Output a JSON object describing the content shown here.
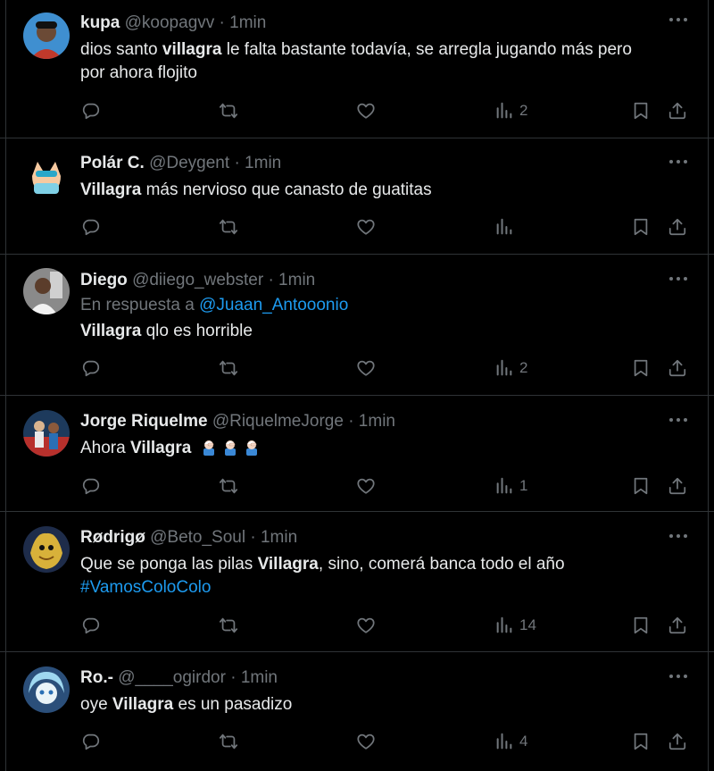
{
  "tweets": [
    {
      "name": "kupa",
      "handle": "@koopagvv",
      "sep": "·",
      "time": "1min",
      "text": {
        "a": "dios santo ",
        "b": "villagra",
        "c": " le falta bastante todavía, se arregla jugando más pero",
        "d": "por ahora flojito"
      },
      "views": "2"
    },
    {
      "name": "Polár C.",
      "handle": "@Deygent",
      "sep": "·",
      "time": "1min",
      "text": {
        "b": "Villagra",
        "c": " más nervioso que canasto de guatitas"
      },
      "views": ""
    },
    {
      "name": "Diego",
      "handle": "@diiego_webster",
      "sep": "·",
      "time": "1min",
      "reply_prefix": "En respuesta a ",
      "reply_to": "@Juaan_Antooonio",
      "text": {
        "b": "Villagra",
        "c": " qlo es horrible"
      },
      "views": "2"
    },
    {
      "name": "Jorge Riquelme",
      "handle": "@RiquelmeJorge",
      "sep": "·",
      "time": "1min",
      "text": {
        "a": "Ahora ",
        "b": "Villagra"
      },
      "emoji": [
        "person-facepalming-emoji",
        "person-facepalming-emoji",
        "person-facepalming-emoji"
      ],
      "views": "1"
    },
    {
      "name": "Rødrigø",
      "handle": "@Beto_Soul",
      "sep": "·",
      "time": "1min",
      "text": {
        "a": "Que se ponga las pilas ",
        "b": "Villagra",
        "c": ", sino, comerá banca todo el año",
        "hashtag": "#VamosColoColo"
      },
      "views": "14"
    },
    {
      "name": "Ro.-",
      "handle": "@____ogirdor",
      "sep": "·",
      "time": "1min",
      "text": {
        "a": "oye ",
        "b": "Villagra",
        "c": " es un pasadizo"
      },
      "views": "4"
    }
  ],
  "icons": [
    "reply-icon",
    "retweet-icon",
    "like-icon",
    "views-icon",
    "bookmark-icon",
    "share-icon",
    "more-icon"
  ],
  "colors": {
    "background": "#000000",
    "text": "#e7e9ea",
    "muted": "#71767b",
    "link": "#1d9bf0",
    "divider": "#2f3336"
  }
}
